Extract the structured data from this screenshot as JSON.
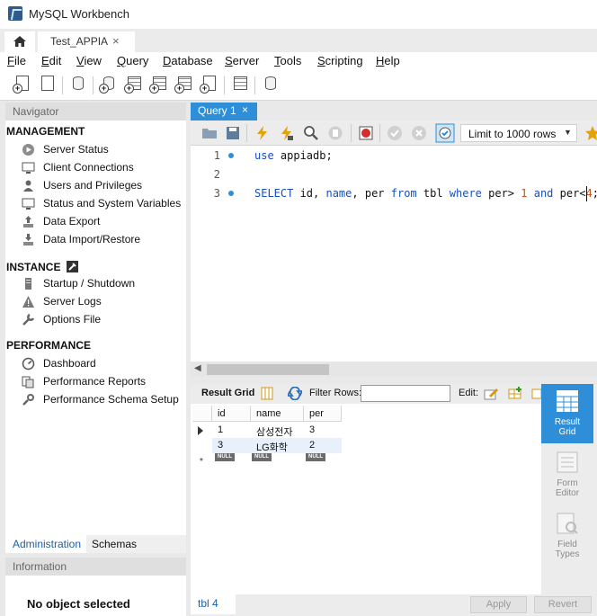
{
  "window": {
    "title": "MySQL Workbench"
  },
  "tabs": {
    "connection": "Test_APPIA",
    "close_glyph": "×"
  },
  "menu": {
    "items": [
      {
        "first": "F",
        "rest": "ile"
      },
      {
        "first": "E",
        "rest": "dit"
      },
      {
        "first": "V",
        "rest": "iew"
      },
      {
        "first": "Q",
        "rest": "uery"
      },
      {
        "first": "D",
        "rest": "atabase"
      },
      {
        "first": "S",
        "rest": "erver"
      },
      {
        "first": "T",
        "rest": "ools"
      },
      {
        "first": "S",
        "rest": "cripting"
      },
      {
        "first": "H",
        "rest": "elp"
      }
    ]
  },
  "navigator": {
    "header": "Navigator",
    "management": {
      "title": "MANAGEMENT",
      "items": [
        "Server Status",
        "Client Connections",
        "Users and Privileges",
        "Status and System Variables",
        "Data Export",
        "Data Import/Restore"
      ]
    },
    "instance": {
      "title": "INSTANCE",
      "items": [
        "Startup / Shutdown",
        "Server Logs",
        "Options File"
      ]
    },
    "performance": {
      "title": "PERFORMANCE",
      "items": [
        "Dashboard",
        "Performance Reports",
        "Performance Schema Setup"
      ]
    },
    "tabs": {
      "administration": "Administration",
      "schemas": "Schemas"
    }
  },
  "information": {
    "header": "Information",
    "empty": "No object selected"
  },
  "editor": {
    "tab": "Query 1",
    "limit": "Limit to 1000 rows",
    "lines": [
      "1",
      "2",
      "3"
    ],
    "code": {
      "line1": {
        "kw": "use",
        "rest": " appiadb;"
      },
      "line3": {
        "kw1": "SELECT",
        "t1": " id, ",
        "kw2": "name",
        "t2": ", per ",
        "kw3": "from",
        "t3": " tbl ",
        "kw4": "where",
        "t4": " per> ",
        "n1": "1",
        "t5": " ",
        "kw5": "and",
        "t6": " per<",
        "n2": "4",
        "t7": ";"
      }
    }
  },
  "result": {
    "grid_label": "Result Grid",
    "filter_label": "Filter Rows:",
    "filter_value": "",
    "edit_label": "Edit:",
    "columns": [
      "id",
      "name",
      "per"
    ],
    "rows": [
      [
        "1",
        "삼성전자",
        "3"
      ],
      [
        "3",
        "LG화학",
        "2"
      ]
    ],
    "null_label": "NULL",
    "new_row_marker": "*",
    "tab": "tbl 4",
    "apply": "Apply",
    "revert": "Revert"
  },
  "side_panel": {
    "result_grid": [
      "Result",
      "Grid"
    ],
    "form_editor": [
      "Form",
      "Editor"
    ],
    "field_types": [
      "Field",
      "Types"
    ]
  },
  "colors": {
    "accent": "#2e8fd8",
    "keyword": "#1a4fb8",
    "number": "#c8501b"
  }
}
